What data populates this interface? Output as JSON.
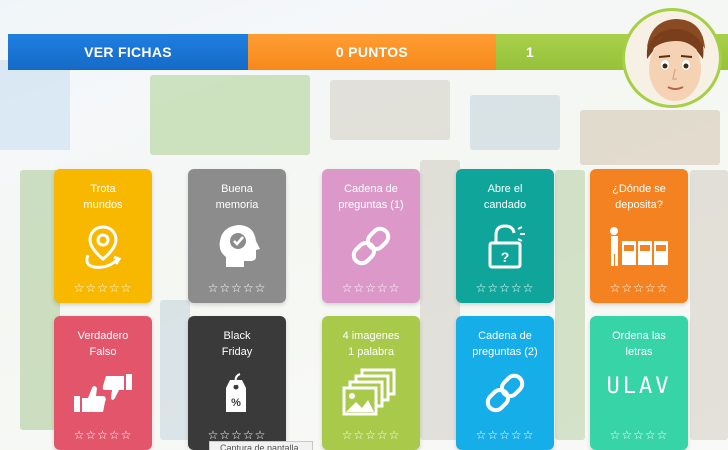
{
  "header": {
    "fichas_label": "VER FICHAS",
    "points_label": "0 PUNTOS",
    "level": "1"
  },
  "cards": [
    {
      "title": "Trota\nmundos",
      "color": "#f9b800",
      "icon": "map-pin-icon",
      "stars": "☆☆☆☆☆"
    },
    {
      "title": "Buena\nmemoria",
      "color": "#8c8c8c",
      "icon": "head-check-icon",
      "stars": "☆☆☆☆☆"
    },
    {
      "title": "Cadena de\npreguntas (1)",
      "color": "#dc98c9",
      "icon": "chain-link-icon",
      "stars": "☆☆☆☆☆"
    },
    {
      "title": "Abre el\ncandado",
      "color": "#0fa59a",
      "icon": "padlock-icon",
      "stars": "☆☆☆☆☆"
    },
    {
      "title": "¿Dónde se\ndeposita?",
      "color": "#f58220",
      "icon": "recycle-bins-icon",
      "stars": "☆☆☆☆☆"
    },
    {
      "title": "Verdadero\nFalso",
      "color": "#e3556b",
      "icon": "thumbs-up-down-icon",
      "stars": "☆☆☆☆☆"
    },
    {
      "title": "Black\nFriday",
      "color": "#3a3a3a",
      "icon": "price-tag-icon",
      "stars": "☆☆☆☆☆"
    },
    {
      "title": "4 imagenes\n1 palabra",
      "color": "#a8c94a",
      "icon": "images-stack-icon",
      "stars": "☆☆☆☆☆"
    },
    {
      "title": "Cadena de\npreguntas (2)",
      "color": "#16aee9",
      "icon": "chain-link-icon",
      "stars": "☆☆☆☆☆"
    },
    {
      "title": "Ordena las\nletras",
      "color": "#36d4a7",
      "icon": "letters-icon",
      "stars": "☆☆☆☆☆",
      "letters": "ULAV"
    }
  ],
  "tooltip": "Captura de pantalla"
}
